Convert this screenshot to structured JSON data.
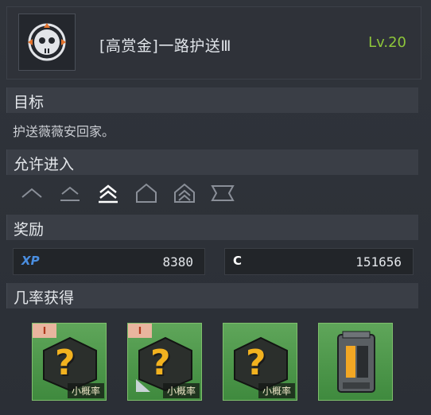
{
  "header": {
    "title": "[高赏金]一路护送Ⅲ",
    "level": "Lv.20",
    "icon": "skull-emblem-icon"
  },
  "objective": {
    "label": "目标",
    "text": "护送薇薇安回家。"
  },
  "entry": {
    "label": "允许进入",
    "difficulties": [
      {
        "icon": "chevron-1-icon",
        "active": false
      },
      {
        "icon": "chevron-2-icon",
        "active": false
      },
      {
        "icon": "chevron-3-icon",
        "active": true
      },
      {
        "icon": "house-icon",
        "active": false
      },
      {
        "icon": "house-chevrons-icon",
        "active": false
      },
      {
        "icon": "banner-icon",
        "active": false
      }
    ]
  },
  "rewards": {
    "label": "奖励",
    "xp_icon": "XP",
    "xp_value": "8380",
    "credits_icon": "C",
    "credits_value": "151656"
  },
  "drops": {
    "label": "几率获得",
    "items": [
      {
        "tag": "I",
        "chance": "小概率",
        "type": "mystery"
      },
      {
        "tag": "I",
        "chance": "小概率",
        "type": "mystery"
      },
      {
        "tag": "",
        "chance": "小概率",
        "type": "mystery"
      },
      {
        "tag": "",
        "chance": "",
        "type": "canister"
      }
    ]
  },
  "colors": {
    "level": "#8ec63a",
    "accent_orange": "#e2722c",
    "item_green": "#4f9a4b",
    "question_gold": "#f2b21f"
  }
}
